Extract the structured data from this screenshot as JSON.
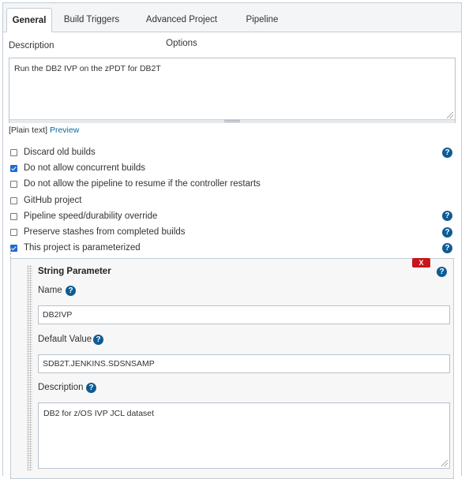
{
  "tabs": [
    {
      "label": "General",
      "active": true
    },
    {
      "label": "Build Triggers",
      "active": false
    },
    {
      "label": "Advanced Project Options",
      "active": false
    },
    {
      "label": "Pipeline",
      "active": false
    }
  ],
  "description": {
    "label": "Description",
    "value": "Run the DB2 IVP on the zPDT for DB2T",
    "plain_text": "[Plain text]",
    "preview": "Preview"
  },
  "options": [
    {
      "label": "Discard old builds",
      "checked": false,
      "help": true
    },
    {
      "label": "Do not allow concurrent builds",
      "checked": true,
      "help": false
    },
    {
      "label": "Do not allow the pipeline to resume if the controller restarts",
      "checked": false,
      "help": false
    },
    {
      "label": "GitHub project",
      "checked": false,
      "help": false
    },
    {
      "label": "Pipeline speed/durability override",
      "checked": false,
      "help": true
    },
    {
      "label": "Preserve stashes from completed builds",
      "checked": false,
      "help": true
    },
    {
      "label": "This project is parameterized",
      "checked": true,
      "help": true
    }
  ],
  "parameter": {
    "title": "String Parameter",
    "close_label": "X",
    "name_label": "Name",
    "name_value": "DB2IVP",
    "default_label": "Default Value",
    "default_value": "SDB2T.JENKINS.SDSNSAMP",
    "description_label": "Description",
    "description_value": "DB2 for z/OS IVP JCL dataset"
  },
  "help_glyph": "?",
  "colors": {
    "accent_link": "#0b6aa2",
    "help_icon": "#0e5b93",
    "checkbox_checked": "#1f6cd0",
    "close_button": "#c9141b"
  }
}
